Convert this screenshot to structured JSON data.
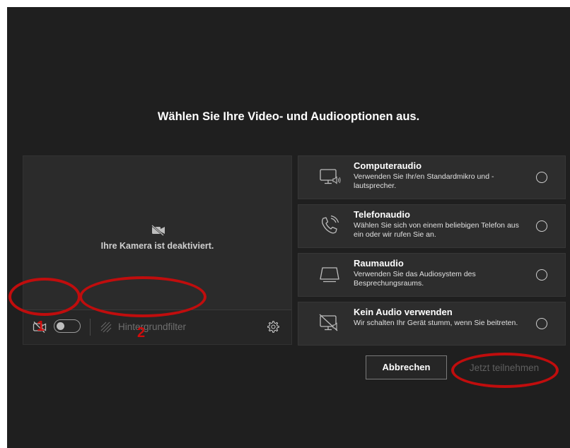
{
  "page": {
    "title": "Wählen Sie Ihre Video- und Audiooptionen aus."
  },
  "camera": {
    "status_text": "Ihre Kamera ist deaktiviert.",
    "toggle_state": "off",
    "background_filter_label": "Hintergrundfilter"
  },
  "audio_options": [
    {
      "icon": "computer-audio-icon",
      "title": "Computeraudio",
      "description": "Verwenden Sie Ihr/en Standardmikro und -lautsprecher.",
      "selected": false
    },
    {
      "icon": "phone-audio-icon",
      "title": "Telefonaudio",
      "description": "Wählen Sie sich von einem beliebigen Telefon aus ein oder wir rufen Sie an.",
      "selected": false
    },
    {
      "icon": "room-audio-icon",
      "title": "Raumaudio",
      "description": "Verwenden Sie das Audiosystem des Besprechungsraums.",
      "selected": false
    },
    {
      "icon": "no-audio-icon",
      "title": "Kein Audio verwenden",
      "description": "Wir schalten Ihr Gerät stumm, wenn Sie beitreten.",
      "selected": false
    }
  ],
  "buttons": {
    "cancel_label": "Abbrechen",
    "join_label": "Jetzt teilnehmen"
  },
  "annotations": {
    "label_1": "1",
    "label_2": "2"
  },
  "colors": {
    "background": "#1f1f1f",
    "panel": "#2d2d2d",
    "annotation": "#c00d0d",
    "disabled_text": "#5f5f5f"
  }
}
